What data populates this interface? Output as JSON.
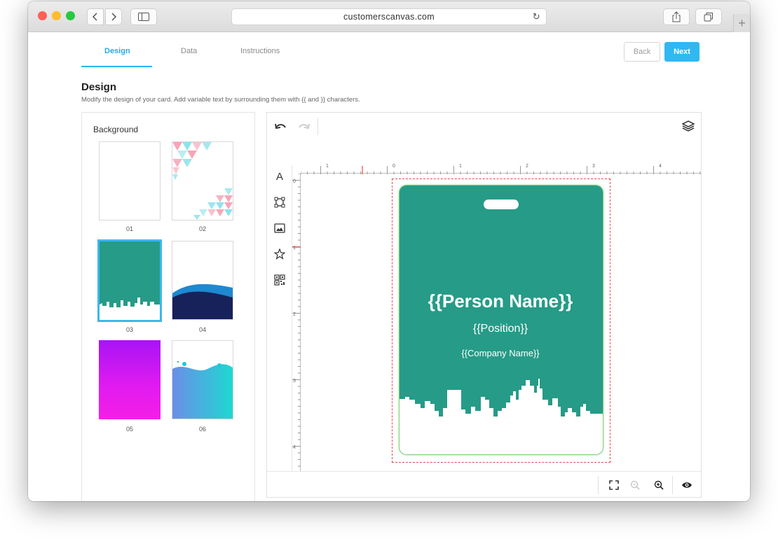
{
  "browser": {
    "url": "customerscanvas.com",
    "lights": [
      "#ff5f57",
      "#febc2e",
      "#28c840"
    ]
  },
  "tabs": [
    {
      "label": "Design",
      "active": true
    },
    {
      "label": "Data",
      "active": false
    },
    {
      "label": "Instructions",
      "active": false
    }
  ],
  "nav": {
    "back_label": "Back",
    "next_label": "Next"
  },
  "page": {
    "title": "Design",
    "subtitle": "Modify the design of your card. Add variable text by surrounding them with {{ and }} characters."
  },
  "background_panel": {
    "heading": "Background",
    "items": [
      {
        "label": "01"
      },
      {
        "label": "02"
      },
      {
        "label": "03",
        "selected": true
      },
      {
        "label": "04"
      },
      {
        "label": "05"
      },
      {
        "label": "06"
      }
    ]
  },
  "ruler": {
    "top": [
      "1",
      "0",
      "1",
      "2",
      "3",
      "4"
    ],
    "left": [
      "0",
      "1",
      "2",
      "3",
      "4"
    ]
  },
  "card": {
    "name": "{{Person Name}}",
    "position": "{{Position}}",
    "company": "{{Company Name}}",
    "color": "#269b87"
  },
  "colors": {
    "accent": "#2fb8f2",
    "selection": "#3bb8ef",
    "bleed": "#e8474f"
  }
}
